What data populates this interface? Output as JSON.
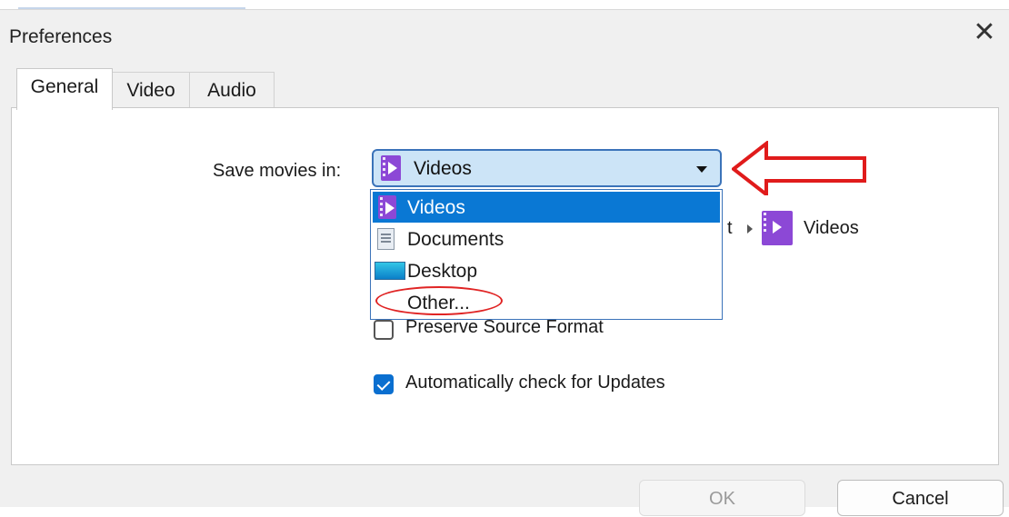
{
  "window": {
    "title": "Preferences"
  },
  "tabs": [
    {
      "label": "General",
      "active": true
    },
    {
      "label": "Video",
      "active": false
    },
    {
      "label": "Audio",
      "active": false
    }
  ],
  "save_location": {
    "label": "Save movies in:",
    "selected": "Videos",
    "options": [
      {
        "label": "Videos",
        "icon": "videos-folder-icon",
        "selected": true
      },
      {
        "label": "Documents",
        "icon": "documents-folder-icon",
        "selected": false
      },
      {
        "label": "Desktop",
        "icon": "desktop-folder-icon",
        "selected": false
      },
      {
        "label": "Other...",
        "icon": null,
        "selected": false
      }
    ]
  },
  "path_display": {
    "partial_text": "t",
    "folder": "Videos",
    "icon": "videos-folder-icon"
  },
  "options": {
    "preserve_source_format": {
      "label": "Preserve Source Format",
      "checked": false
    },
    "auto_check_updates": {
      "label": "Automatically check for Updates",
      "checked": true
    }
  },
  "buttons": {
    "ok": "OK",
    "cancel": "Cancel"
  },
  "annotations": {
    "arrow_color": "#e01b1b",
    "ellipse_color": "#e02424"
  },
  "colors": {
    "accent": "#0a78d4",
    "combo_bg": "#cce4f7",
    "video_icon": "#8c48d6"
  }
}
